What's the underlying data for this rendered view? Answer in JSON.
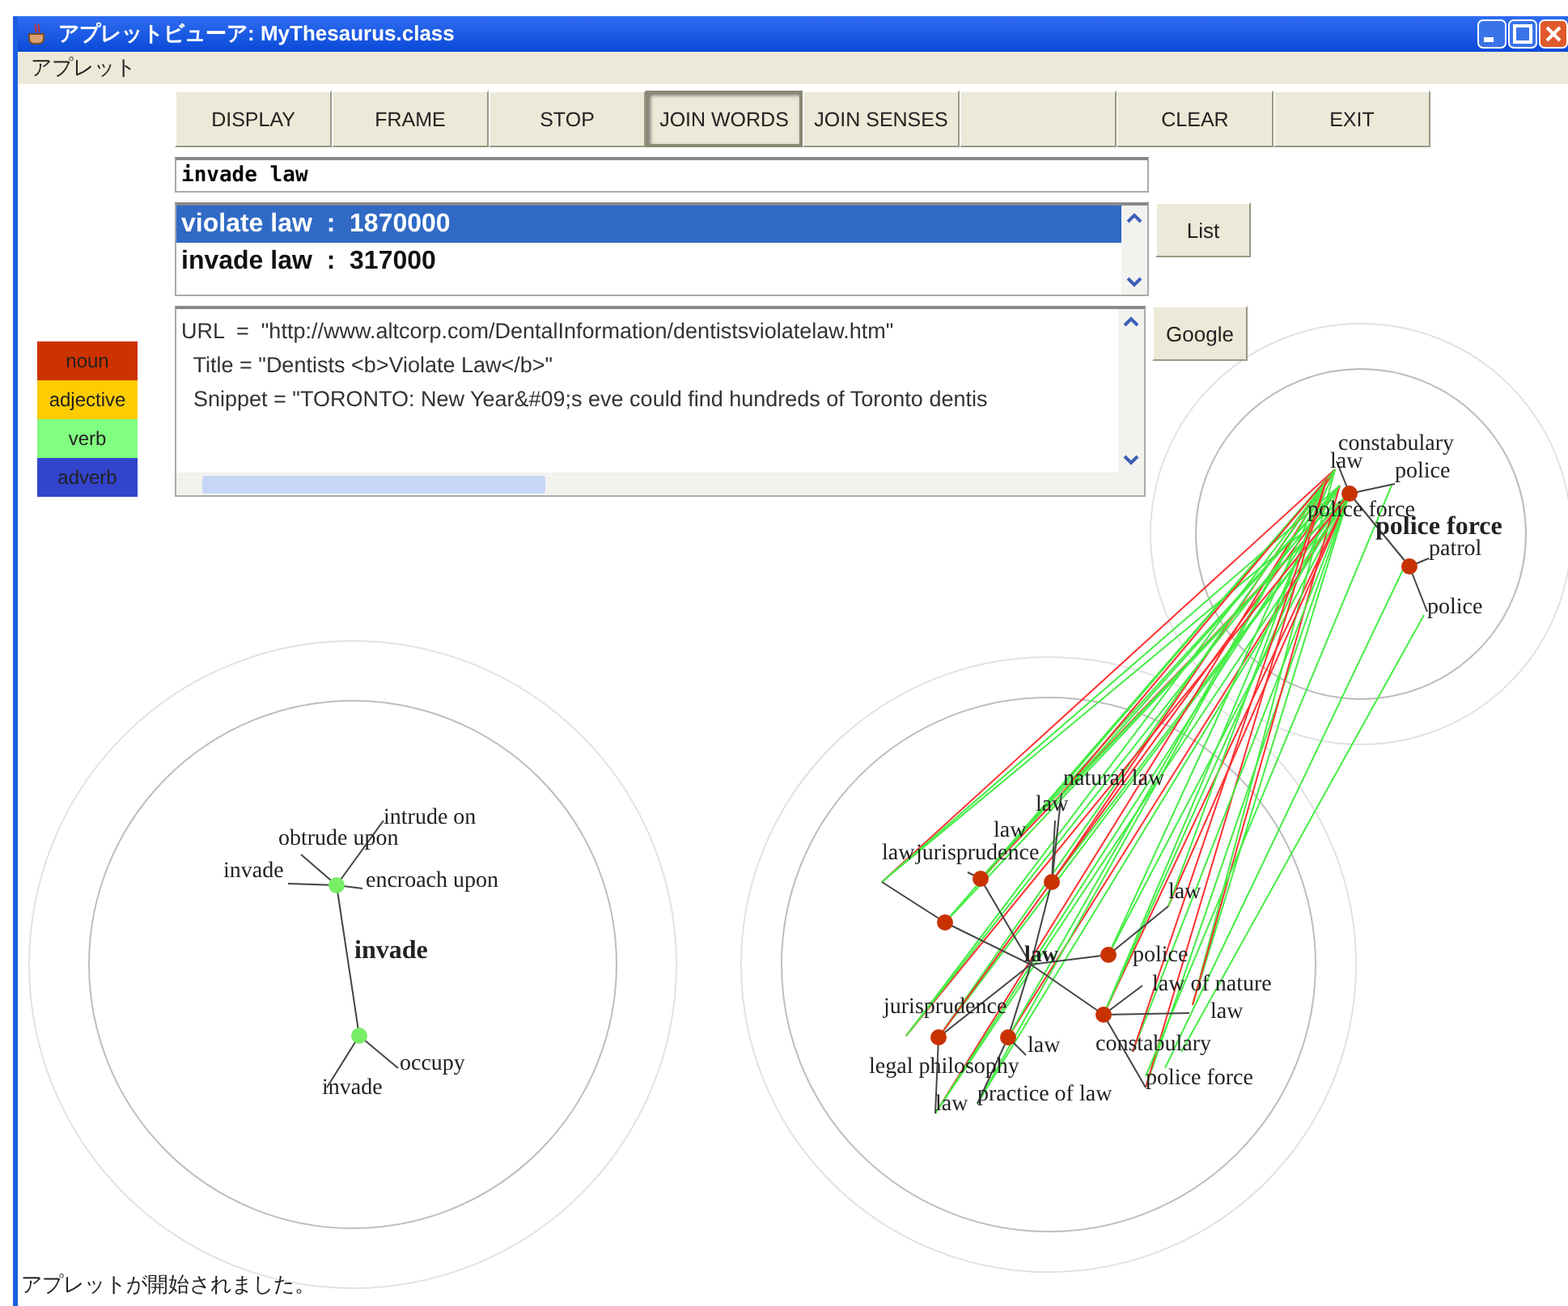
{
  "window": {
    "title": "アプレットビューア: MyThesaurus.class"
  },
  "menu": [
    "アプレット"
  ],
  "toolbar": [
    {
      "label": "DISPLAY",
      "pressed": false
    },
    {
      "label": "FRAME",
      "pressed": false
    },
    {
      "label": "STOP",
      "pressed": false
    },
    {
      "label": "JOIN WORDS",
      "pressed": true
    },
    {
      "label": "JOIN SENSES",
      "pressed": false
    },
    {
      "label": "CLEAR",
      "pressed": false
    },
    {
      "label": "EXIT",
      "pressed": false
    }
  ],
  "query": {
    "value": "invade law"
  },
  "results": [
    {
      "text": "violate law  :  1870000",
      "selected": true
    },
    {
      "text": "invade law  :  317000",
      "selected": false
    }
  ],
  "list_button": "List",
  "google_button": "Google",
  "snippet_lines": [
    "URL  =  \"http://www.altcorp.com/DentalInformation/dentistsviolatelaw.htm\"",
    "  Title = \"Dentists <b>Violate Law</b>\"",
    "  Snippet = \"TORONTO: New Year&#09;s eve could find hundreds of Toronto dentis"
  ],
  "legend": [
    {
      "label": "noun",
      "color": "#cc3300"
    },
    {
      "label": "adjective",
      "color": "#ffcc00"
    },
    {
      "label": "verb",
      "color": "#80ff80"
    },
    {
      "label": "adverb",
      "color": "#3344cc"
    }
  ],
  "graphs": [
    {
      "kind": "verb",
      "center": "invade",
      "labels": [
        "intrude on",
        "obtrude upon",
        "invade",
        "encroach upon",
        "occupy",
        "invade"
      ]
    },
    {
      "kind": "noun",
      "center": "law",
      "labels": [
        "natural law",
        "law",
        "law",
        "law",
        "jurisprudence",
        "law",
        "police",
        "law of nature",
        "law",
        "jurisprudence",
        "law",
        "legal philosophy",
        "law",
        "practice of law",
        "constabulary",
        "police force"
      ]
    },
    {
      "kind": "noun",
      "center": "police force",
      "labels": [
        "constabulary",
        "law",
        "police",
        "police force",
        "patrol",
        "police"
      ]
    }
  ],
  "status": "アプレットが開始されました。"
}
